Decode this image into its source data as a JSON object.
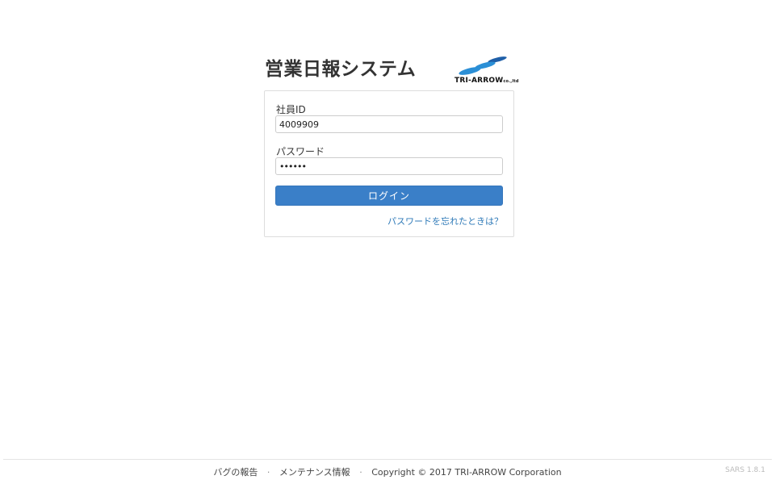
{
  "header": {
    "title": "営業日報システム",
    "logo_name": "TRI-ARROW",
    "logo_suffix": "co.,ltd"
  },
  "login": {
    "employee_id_label": "社員ID",
    "employee_id_value": "4009909",
    "password_label": "パスワード",
    "password_value": "••••••",
    "login_button": "ログイン",
    "forgot_link": "パスワードを忘れたときは？"
  },
  "footer": {
    "bug_report": "バグの報告",
    "separator": "·",
    "maintenance": "メンテナンス情報",
    "copyright": "Copyright © 2017 TRI-ARROW Corporation",
    "version": "SARS 1.8.1"
  },
  "colors": {
    "accent": "#3a7fc8",
    "link": "#2f7ab8",
    "logo_blue_dark": "#1f5fa8",
    "logo_blue_light": "#2b8fd6"
  }
}
